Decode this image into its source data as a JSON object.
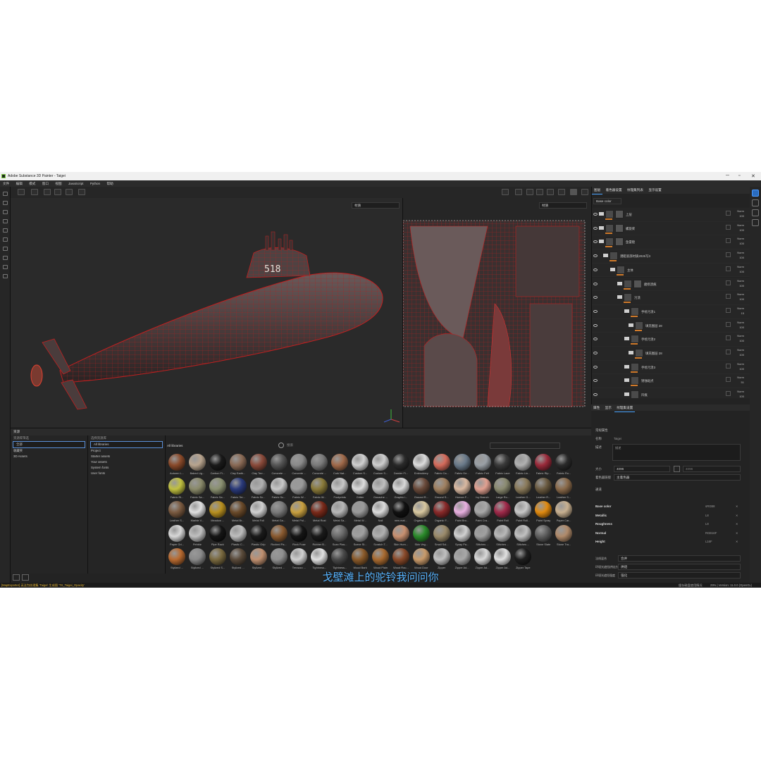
{
  "window": {
    "title": "Adobe Substance 3D Painter - Taigei",
    "min": "─",
    "max": "▫",
    "close": "✕"
  },
  "menu": [
    "文件",
    "编辑",
    "模式",
    "窗口",
    "视图",
    "JavaScript",
    "Python",
    "帮助"
  ],
  "viewport": {
    "left_dropdown": "材质",
    "right_dropdown": "材质",
    "hull_number": "518"
  },
  "right_panel": {
    "tabs": [
      "图层",
      "着色器设置",
      "纹理集列表",
      "显示设置"
    ],
    "channel_dropdown": "Base color",
    "layers": [
      {
        "name": "上层",
        "opacity": "100",
        "blend": "Norm"
      },
      {
        "name": "螺旋桨",
        "opacity": "100",
        "blend": "Norm"
      },
      {
        "name": "鱼雷舱",
        "opacity": "100",
        "blend": "Norm"
      },
      {
        "name": "潜艇底部材质2026写3",
        "opacity": "100",
        "blend": "Norm"
      },
      {
        "name": "主体",
        "opacity": "100",
        "blend": "Norm"
      },
      {
        "name": "磨损渍痕",
        "opacity": "100",
        "blend": "Norm"
      },
      {
        "name": "污渍",
        "opacity": "100",
        "blend": "Norm"
      },
      {
        "name": "手绘污渍1",
        "opacity": "15",
        "blend": "Norm"
      },
      {
        "name": "填充图层 28",
        "opacity": "100",
        "blend": "Norm"
      },
      {
        "name": "手绘污渍2",
        "opacity": "100",
        "blend": "Norm"
      },
      {
        "name": "填充图层 28",
        "opacity": "100",
        "blend": "Norm"
      },
      {
        "name": "手绘污渍3",
        "opacity": "100",
        "blend": "Norm"
      },
      {
        "name": "锈蚀斑点",
        "opacity": "51",
        "blend": "Norm"
      },
      {
        "name": "凹痕",
        "opacity": "100",
        "blend": "Norm"
      }
    ]
  },
  "properties": {
    "tabs": [
      "属性",
      "显示",
      "纹理集设置"
    ],
    "section_title": "常规属性",
    "name_label": "名称",
    "name_value": "Taigei",
    "desc_label": "描述",
    "desc_placeholder": "描述",
    "size_label": "大小",
    "size_value": "4096",
    "size_value2": "4096",
    "shader_label": "着色器链接",
    "shader_value": "主着色器",
    "channels_title": "通道",
    "channels": [
      {
        "name": "Base color",
        "format": "sRGB8"
      },
      {
        "name": "Metallic",
        "format": "L8"
      },
      {
        "name": "Roughness",
        "format": "L8"
      },
      {
        "name": "Normal",
        "format": "RGB16F"
      },
      {
        "name": "Height",
        "format": "L16F"
      }
    ],
    "bottom_rows": [
      {
        "label": "法线混合",
        "value": "合并"
      },
      {
        "label": "环境光遮挡烘焙方法",
        "value": "烘焙"
      },
      {
        "label": "环境光遮挡强度",
        "value": "强化"
      }
    ]
  },
  "shelf": {
    "title": "资源",
    "col1_header": "资源库筛选",
    "col1_items": [
      "全部",
      "收藏夹",
      "3D Assets"
    ],
    "col2_header": "选择资源库",
    "col2_items": [
      "All libraries",
      "Project",
      "Starter assets",
      "Your assets",
      "System fonts",
      "User fonts"
    ],
    "breadcrumb": "All libraries",
    "search_placeholder": "搜索",
    "materials": [
      "Autumn L...",
      "Baked Lig...",
      "Carbon Fi...",
      "Clay Earth...",
      "Clay Terr...",
      "Concrete ...",
      "Concrete ...",
      "Concrete ...",
      "Cork Nat...",
      "Custom S...",
      "Custom S...",
      "Damier Fi...",
      "Embroidery",
      "Fabric Ca...",
      "Fabric De...",
      "Fabric Felt",
      "Fabric Lace",
      "Fabric Lin...",
      "Fabric Rip...",
      "Fabric Ro...",
      "Fabric Ri...",
      "Fabric Sa...",
      "Fabric Sa...",
      "Fabric Ter...",
      "Fabric Sc...",
      "Fabric Sc...",
      "Fabric W...",
      "Fabric W...",
      "Footprints",
      "Gritter",
      "Gouache ...",
      "Graphic i...",
      "Ground R...",
      "Ground S...",
      "Human F...",
      "Ivy Branch",
      "Large Ro...",
      "Leather G...",
      "Leather R...",
      "Leather S...",
      "Leather S...",
      "Marble V...",
      "Meadow ...",
      "Metal Br...",
      "Metal Foil",
      "Metal Ga...",
      "Metal Pol...",
      "Metal Rust",
      "Metal Sa...",
      "Metal W...",
      "Nail",
      "new mat...",
      "Organic B...",
      "Organic F...",
      "Paint Bro...",
      "Paint Cra...",
      "Paint Roll",
      "Paint Roll...",
      "Paint Spray",
      "Paper Car...",
      "Paper Gri...",
      "Pebble",
      "Pipe Rack",
      "Plastic C...",
      "Plastic Grip",
      "Rocked Pa...",
      "Rock Fuse",
      "Rubber B...",
      "Scan Plas...",
      "Scene St...",
      "Scratch T...",
      "Skin Hum...",
      "Skin Veg...",
      "Small Sul...",
      "Spray Pa...",
      "Stitches ...",
      "Stitches ...",
      "Stitches ...",
      "Stone Slate",
      "Stone Tra...",
      "Stylized ...",
      "Stylized ...",
      "Stylized S...",
      "Stylized ...",
      "Stylized ...",
      "Stylized ...",
      "Terrazzo ...",
      "Tightness...",
      "Tightness...",
      "Wood Bark",
      "Wood Plain",
      "Wood Rou...",
      "Wood Door",
      "Zipper",
      "Zipper Ad...",
      "Zipper Ad...",
      "Zipper Ad...",
      "Zipper Tape"
    ],
    "colors": [
      "#8a4a2a",
      "#b8a48e",
      "#1a1a1a",
      "#8a6a55",
      "#8a4a3a",
      "#555555",
      "#8a8a8a",
      "#7a7a7a",
      "#a06a4a",
      "#d0d0d0",
      "#cfcfcf",
      "#2a2a2a",
      "#dcdcdc",
      "#d56b5b",
      "#6a7a8a",
      "#9aa0a6",
      "#3a3a3a",
      "#b0b0b0",
      "#9a2a3a",
      "#2a2a2a",
      "#c0c040",
      "#8a8a6a",
      "#8a9070",
      "#2a3a7a",
      "#b0b0b0",
      "#c8c8c8",
      "#9a9a9a",
      "#8a7a3a",
      "#c8c8c8",
      "#dcdcdc",
      "#bfbfbf",
      "#d8d8d8",
      "#6a4a3a",
      "#a08060",
      "#d9b8a0",
      "#e0a090",
      "#8a8a70",
      "#8a7a5a",
      "#6a5a40",
      "#8a6a4a",
      "#7a5a40",
      "#e0e0e0",
      "#b89020",
      "#6a4a2a",
      "#d0d0d0",
      "#7a7a7a",
      "#c8a040",
      "#7a2a1a",
      "#b8b8b8",
      "#9a9a9a",
      "#dcdcdc",
      "#111111",
      "#d8c8a0",
      "#8a2a2a",
      "#e8b0e0",
      "#a8a8a8",
      "#a02a4a",
      "#c8c8c8",
      "#e08a10",
      "#c8b090",
      "#d8d8d8",
      "#c0c0c0",
      "#151515",
      "#bdbdbd",
      "#1a1a1a",
      "#8a5a30",
      "#151515",
      "#1a1a1a",
      "#6a6a6a",
      "#a0a0a0",
      "#b0b0b0",
      "#c89070",
      "#2a8a2a",
      "#9a8a6a",
      "#d0d0d0",
      "#a0a0a0",
      "#b8b8b8",
      "#c0c0c0",
      "#606060",
      "#b08a6a",
      "#b86a30",
      "#8a8a8a",
      "#7a6a40",
      "#5a4a3a",
      "#c09070",
      "#909090",
      "#d0d0d0",
      "#e0e0e0",
      "#4a4a4a",
      "#8a5a2a",
      "#a86a30",
      "#8a4a2a",
      "#c89a6a",
      "#c0c0c0",
      "#a8a8a8",
      "#d8d8d8",
      "#e0e0e0",
      "#1e1e1e"
    ]
  },
  "status": {
    "left": "[MapExporter] 无法为纹理集 'Taigei' 生成图 'TX_Taigei_Opacity'",
    "right_msg": "缓存磁盘使用情况",
    "right_ver": "29% | Version: 11.0.0 (OpenGL)"
  },
  "subtitle": "戈壁滩上的驼铃我问问你"
}
